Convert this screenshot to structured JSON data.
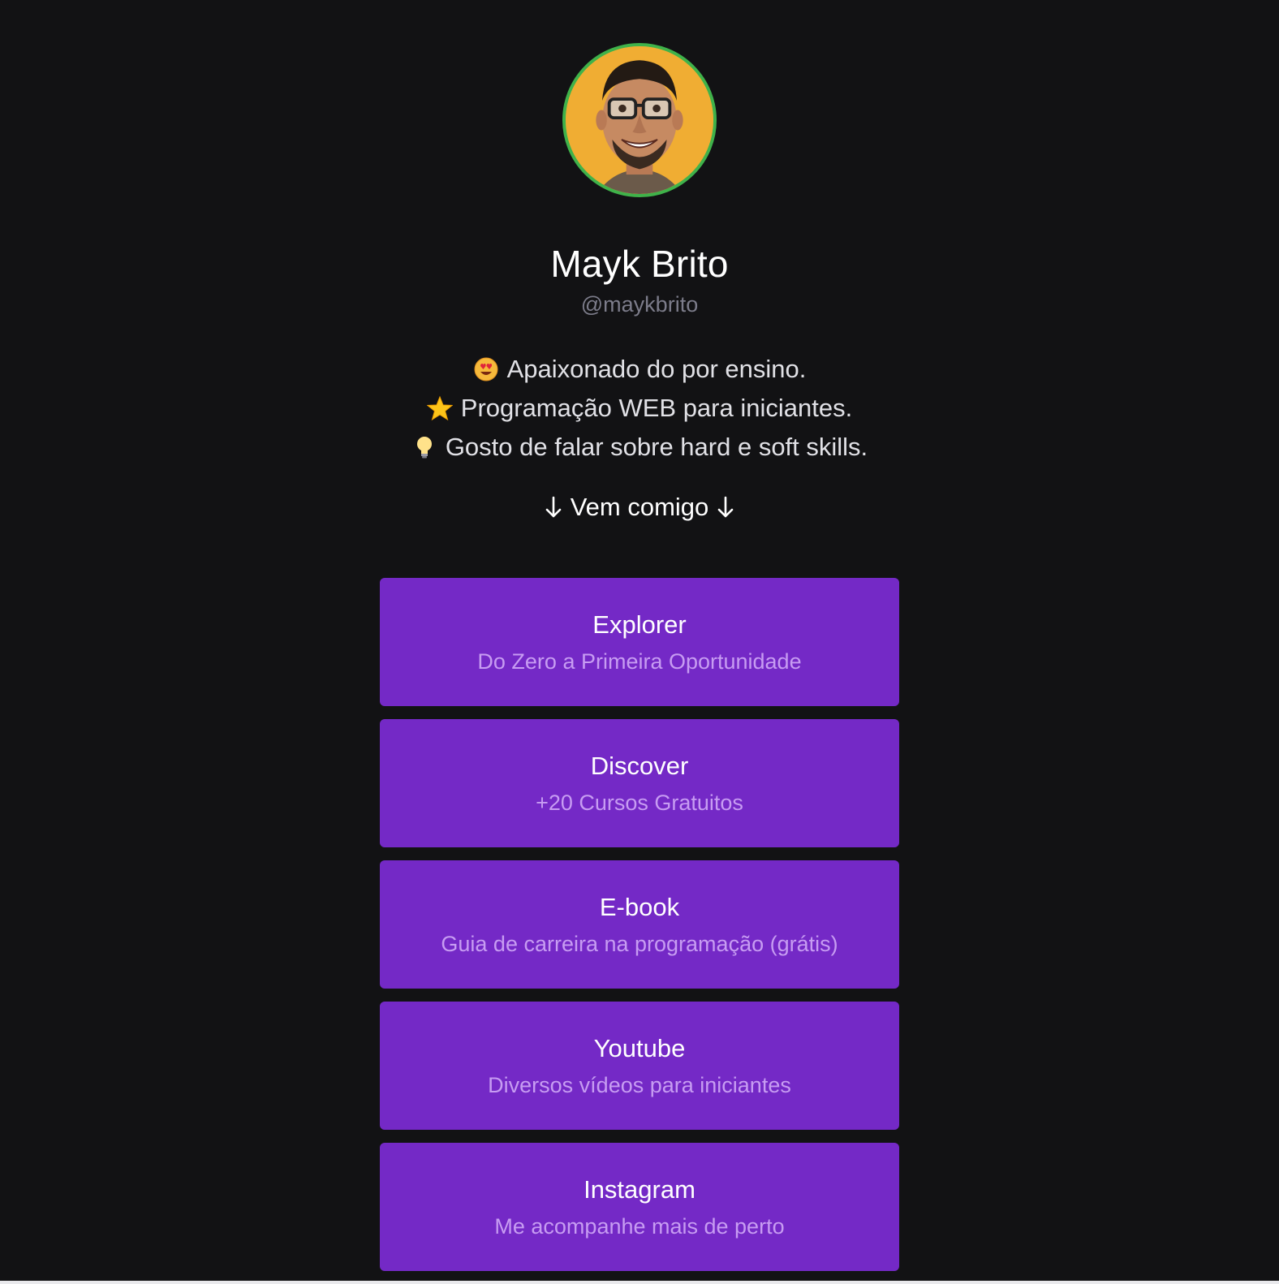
{
  "profile": {
    "name": "Mayk Brito",
    "handle": "@maykbrito",
    "avatar_alt": "Mayk Brito"
  },
  "bio": {
    "lines": [
      {
        "icon": "heart-eyes-emoji-icon",
        "text": "Apaixonado do por ensino."
      },
      {
        "icon": "star-emoji-icon",
        "text": "Programação WEB para iniciantes."
      },
      {
        "icon": "lightbulb-emoji-icon",
        "text": "Gosto de falar sobre hard e soft skills."
      }
    ]
  },
  "cta": {
    "text": "Vem comigo",
    "left_icon": "arrow-down-icon",
    "right_icon": "arrow-down-icon"
  },
  "links": [
    {
      "title": "Explorer",
      "subtitle": "Do Zero a Primeira Oportunidade"
    },
    {
      "title": "Discover",
      "subtitle": "+20 Cursos Gratuitos"
    },
    {
      "title": "E-book",
      "subtitle": "Guia de carreira na programação (grátis)"
    },
    {
      "title": "Youtube",
      "subtitle": "Diversos vídeos para iniciantes"
    },
    {
      "title": "Instagram",
      "subtitle": "Me acompanhe mais de perto"
    }
  ],
  "colors": {
    "background": "#121214",
    "card": "#7429c6",
    "card_subtitle": "#c79cf2",
    "avatar_border": "#3fb24a",
    "avatar_bg": "#f0ad33",
    "handle": "#7c7c8a"
  }
}
